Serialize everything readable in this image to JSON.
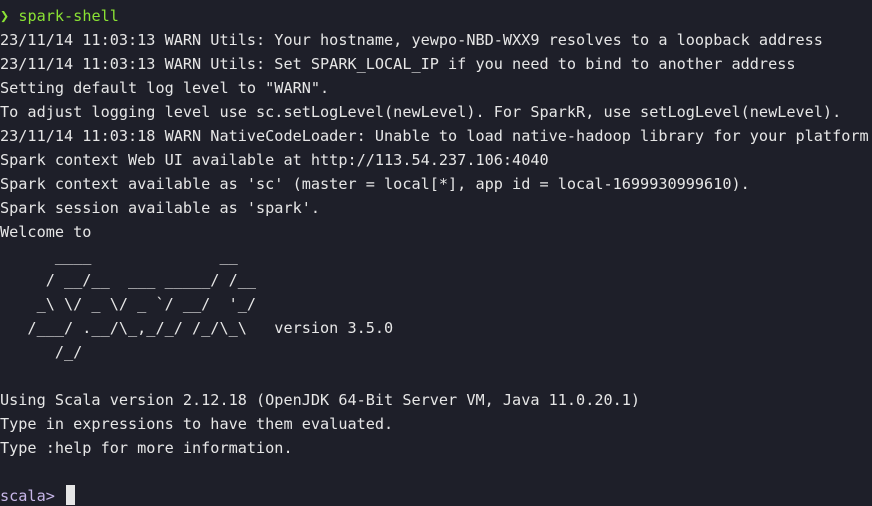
{
  "shell": {
    "prompt_glyph": "❯",
    "command": "spark-shell"
  },
  "output": [
    "23/11/14 11:03:13 WARN Utils: Your hostname, yewpo-NBD-WXX9 resolves to a loopback address",
    "23/11/14 11:03:13 WARN Utils: Set SPARK_LOCAL_IP if you need to bind to another address",
    "Setting default log level to \"WARN\".",
    "To adjust logging level use sc.setLogLevel(newLevel). For SparkR, use setLogLevel(newLevel).",
    "23/11/14 11:03:18 WARN NativeCodeLoader: Unable to load native-hadoop library for your platform",
    "Spark context Web UI available at http://113.54.237.106:4040",
    "Spark context available as 'sc' (master = local[*], app id = local-1699930999610).",
    "Spark session available as 'spark'.",
    "Welcome to"
  ],
  "banner": [
    "      ____              __",
    "     / __/__  ___ _____/ /__",
    "    _\\ \\/ _ \\/ _ `/ __/  '_/",
    "   /___/ .__/\\_,_/_/ /_/\\_\\   version 3.5.0",
    "      /_/"
  ],
  "info": [
    "Using Scala version 2.12.18 (OpenJDK 64-Bit Server VM, Java 11.0.20.1)",
    "Type in expressions to have them evaluated.",
    "Type :help for more information."
  ],
  "repl": {
    "prompt": "scala> "
  },
  "colors": {
    "background": "#1e1f29",
    "foreground": "#e6e6e6",
    "prompt_green": "#8ae234",
    "scala_prompt": "#c7b6e8"
  }
}
